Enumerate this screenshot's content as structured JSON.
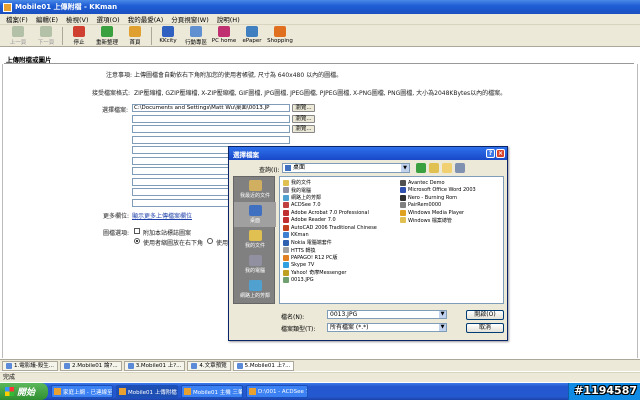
{
  "window": {
    "title": "Mobile01 上傳附檔 - KKman"
  },
  "menu": [
    "檔案(F)",
    "編輯(E)",
    "檢視(V)",
    "選項(O)",
    "我的最愛(A)",
    "分頁視窗(W)",
    "說明(H)"
  ],
  "toolbar": [
    {
      "label": "上一頁",
      "disabled": true,
      "color": "#7a9a7a"
    },
    {
      "label": "下一頁",
      "disabled": true,
      "color": "#7a9a7a"
    },
    {
      "label": "停止",
      "disabled": false,
      "color": "#d04030"
    },
    {
      "label": "重新整理",
      "disabled": false,
      "color": "#3aa040"
    },
    {
      "label": "首頁",
      "disabled": false,
      "color": "#e0a030"
    },
    {
      "label": "KKcity",
      "disabled": false,
      "color": "#3060c0"
    },
    {
      "label": "行動專區",
      "disabled": false,
      "color": "#6090d0"
    },
    {
      "label": "PC home",
      "disabled": false,
      "color": "#c03070"
    },
    {
      "label": "ePaper",
      "disabled": false,
      "color": "#4080c0"
    },
    {
      "label": "Shopping",
      "disabled": false,
      "color": "#e07020"
    }
  ],
  "page": {
    "section_title": "上傳附檔或圖片",
    "notice_label": "注意事項:",
    "notice_text": "上傳圖檔會自動依右下角附加您的使用者帳號, 尺寸為 640x480 以內的圖檔。",
    "formats_label": "接受檔案格式:",
    "formats_text": "ZIP壓縮檔, GZIP壓縮檔, X-ZIP壓縮檔, GIF圖檔, JPG圖檔, JPEG圖檔, PJPEG圖檔, X-PNG圖檔, PNG圖檔, 大小為2048KBytes以內的檔案。",
    "select_label": "選擇檔案:",
    "file_value": "C:\\Documents and Settings\\Matt Wu\\桌面\\0013.JP",
    "browse_label": "瀏覽...",
    "more_label": "更多欄位:",
    "more_link": "顯示更多上傳檔案欄位",
    "options_label": "圖檔選項:",
    "opt1": "附加本站標誌圖案",
    "opt2": "使用者縮圖放在右下角",
    "opt3": "使用"
  },
  "dialog": {
    "title": "選擇檔案",
    "look_in_label": "查詢(I):",
    "look_in_value": "桌面",
    "places": [
      {
        "label": "我最近的文件",
        "color": "#d0b060"
      },
      {
        "label": "桌面",
        "color": "#4070c0"
      },
      {
        "label": "我的文件",
        "color": "#e0c050"
      },
      {
        "label": "我的電腦",
        "color": "#9090a0"
      },
      {
        "label": "網路上的芳鄰",
        "color": "#50a0d0"
      }
    ],
    "files_col1": [
      {
        "name": "我的文件",
        "color": "#e0c050"
      },
      {
        "name": "我的電腦",
        "color": "#9090a0"
      },
      {
        "name": "網路上的芳鄰",
        "color": "#50a0d0"
      },
      {
        "name": "ACDSee 7.0",
        "color": "#c04040"
      },
      {
        "name": "Adobe Acrobat 7.0 Professional",
        "color": "#c03030"
      },
      {
        "name": "Adobe Reader 7.0",
        "color": "#c03030"
      },
      {
        "name": "AutoCAD 2006 Traditional Chinese",
        "color": "#c04020"
      },
      {
        "name": "KKman",
        "color": "#4080d0"
      },
      {
        "name": "Nokia 電腦端套件",
        "color": "#3060b0"
      },
      {
        "name": "HTTS 轉換",
        "color": "#a0a0a0"
      },
      {
        "name": "PAPAGO! R12 PC版",
        "color": "#e08020"
      },
      {
        "name": "Skype 7V",
        "color": "#30a0e0"
      },
      {
        "name": "Yahoo! 奇摩Messenger",
        "color": "#c0a020"
      },
      {
        "name": "0013.JPG",
        "color": "#70a070"
      }
    ],
    "files_col2": [
      {
        "name": "Avantec Demo",
        "color": "#505050"
      },
      {
        "name": "Microsoft Office Word 2003",
        "color": "#3050b0"
      },
      {
        "name": "Nero - Burning Rom",
        "color": "#303030"
      },
      {
        "name": "PairRem0000",
        "color": "#808080"
      },
      {
        "name": "Windows Media Player",
        "color": "#e0a020"
      },
      {
        "name": "Windows 檔案總管",
        "color": "#e0c050"
      }
    ],
    "filename_label": "檔名(N):",
    "filename_value": "0013.JPG",
    "filetype_label": "檔案類型(T):",
    "filetype_value": "所有檔案 (*.*)",
    "open_label": "開啟(O)",
    "cancel_label": "取消"
  },
  "doc_tabs": [
    "1.電影議-殺生...",
    "2.Mobile01 論?...",
    "3.Mobile01 上?...",
    "4.文章預覽",
    "5.Mobile01 上?..."
  ],
  "status_text": "完成",
  "taskbar": {
    "start_label": "開始",
    "buttons": [
      "家庭上網 - 已連線至...",
      "Mobile01 上傳附檔 -...",
      "Mobile01 主機 三筆...",
      "D:\\001 - ACDSee 7.0"
    ]
  },
  "watermark": "#1194587"
}
